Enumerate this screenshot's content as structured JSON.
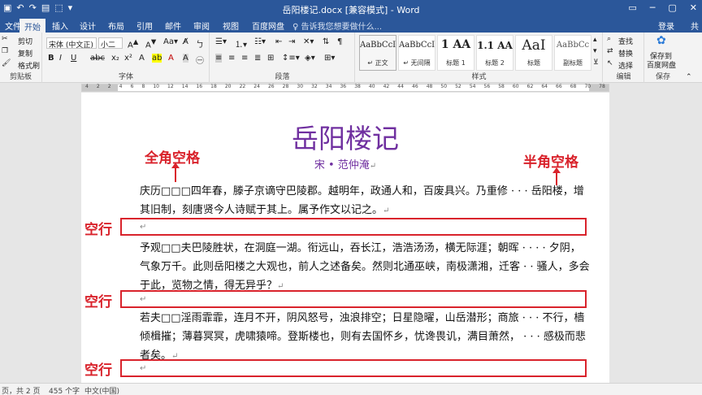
{
  "window": {
    "title": "岳阳楼记.docx [兼容模式] - Word",
    "controls": [
      "▭",
      "─",
      "▢",
      "✕"
    ]
  },
  "qat": [
    "▣",
    "↶",
    "↷",
    "▤",
    "⬚",
    "▾"
  ],
  "tabs": [
    {
      "label": "文件"
    },
    {
      "label": "开始",
      "active": true
    },
    {
      "label": "插入"
    },
    {
      "label": "设计"
    },
    {
      "label": "布局"
    },
    {
      "label": "引用"
    },
    {
      "label": "邮件"
    },
    {
      "label": "审阅"
    },
    {
      "label": "视图"
    },
    {
      "label": "百度网盘"
    }
  ],
  "tell_me": "♀ 告诉我您想要做什么...",
  "account": {
    "login": "登录",
    "share": "共"
  },
  "ribbon": {
    "clipboard": {
      "cut": "剪切",
      "copy": "复制",
      "paint": "格式刷",
      "label": "剪贴板"
    },
    "font": {
      "name": "宋体 (中文正)",
      "size": "小二",
      "label": "字体"
    },
    "paragraph": {
      "label": "段落"
    },
    "styles": {
      "label": "样式",
      "items": [
        {
          "sample": "AaBbCcI",
          "name": "↵ 正文",
          "selected": true
        },
        {
          "sample": "AaBbCcI",
          "name": "↵ 无间隔"
        },
        {
          "sample": "1 AA",
          "name": "标题 1"
        },
        {
          "sample": "1.1 AA",
          "name": "标题 2"
        },
        {
          "sample": "AaI",
          "name": "标题"
        },
        {
          "sample": "AaBbCc",
          "name": "副标题"
        }
      ]
    },
    "editing": {
      "find": "查找",
      "replace": "替换",
      "select": "选择",
      "label": "编辑"
    },
    "save": {
      "line1": "保存到",
      "line2": "百度网盘",
      "label": "保存"
    }
  },
  "ruler": {
    "numbers": [
      "4",
      "2",
      "2",
      "4",
      "6",
      "8",
      "10",
      "12",
      "14",
      "16",
      "18",
      "20",
      "22",
      "24",
      "26",
      "28",
      "30",
      "32",
      "34",
      "36",
      "38",
      "40",
      "42",
      "44",
      "46",
      "48",
      "50",
      "52",
      "54",
      "56",
      "58",
      "60",
      "62",
      "64",
      "66",
      "68",
      "70",
      "78"
    ]
  },
  "document": {
    "title": "岳阳楼记",
    "author": "宋 • 范仲淹",
    "paragraphs": [
      "庆历□□□四年春，滕子京谪守巴陵郡。越明年，政通人和，百废具兴。乃重修 · · · 岳阳楼，增其旧制，刻唐贤今人诗赋于其上。属予作文以记之。",
      "予观□□夫巴陵胜状，在洞庭一湖。衔远山，吞长江，浩浩汤汤，横无际涯；朝晖 · · · · 夕阴，气象万千。此则岳阳楼之大观也，前人之述备矣。然则北通巫峡，南极潇湘，迁客 · · 骚人，多会于此，览物之情，得无异乎？",
      "若夫□□淫雨霏霏，连月不开，阴风怒号，浊浪排空；日星隐曜，山岳潜形；商旅 · · · 不行，樯倾楫摧；薄暮冥冥，虎啸猿啼。登斯楼也，则有去国怀乡，忧谗畏讥，满目萧然， · · · 感极而悲者矣。"
    ],
    "para_mark": "↵"
  },
  "annotations": {
    "full_width": "全角空格",
    "half_width": "半角空格",
    "empty_line": "空行"
  },
  "statusbar": {
    "page": "页，共 2 页",
    "words": "455 个字",
    "lang": "中文(中国)"
  },
  "colors": {
    "accent": "#2b579a",
    "title": "#7030a0",
    "annotation": "#d9232c"
  }
}
